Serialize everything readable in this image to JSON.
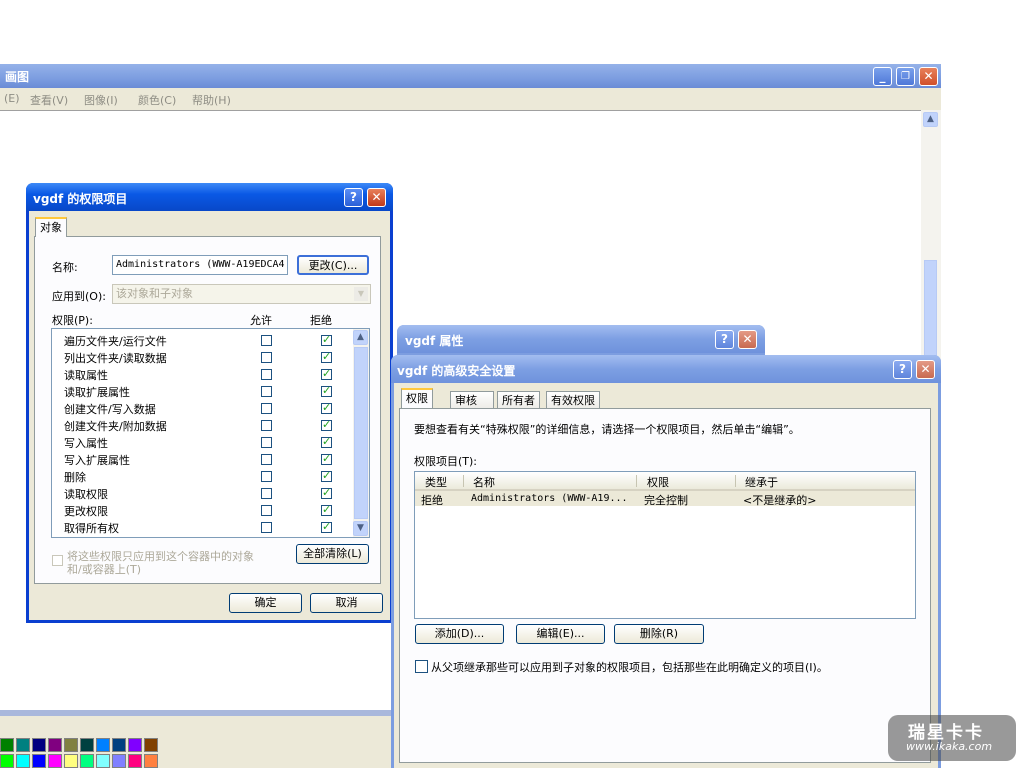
{
  "paint": {
    "title": "画图",
    "menus": [
      "(E)",
      "查看(V)",
      "图像(I)",
      "颜色(C)",
      "帮助(H)"
    ],
    "palette_top": [
      "#008000",
      "#008080",
      "#000080",
      "#800080",
      "#808040",
      "#004040",
      "#0080ff",
      "#004080",
      "#8000ff",
      "#804000"
    ],
    "palette_bottom": [
      "#00ff00",
      "#00ffff",
      "#0000ff",
      "#ff00ff",
      "#ffff80",
      "#00ff80",
      "#80ffff",
      "#8080ff",
      "#ff0080",
      "#ff8040"
    ]
  },
  "perm_entry": {
    "title": "vgdf 的权限项目",
    "tab": "对象",
    "name_label": "名称:",
    "name_value": "Administrators (WWW-A19EDCA4",
    "change_button": "更改(C)...",
    "apply_label": "应用到(O):",
    "apply_value": "该对象和子对象",
    "permissions_label": "权限(P):",
    "col_allow": "允许",
    "col_deny": "拒绝",
    "rows": [
      {
        "label": "遍历文件夹/运行文件",
        "allow": false,
        "deny": true
      },
      {
        "label": "列出文件夹/读取数据",
        "allow": false,
        "deny": true
      },
      {
        "label": "读取属性",
        "allow": false,
        "deny": true
      },
      {
        "label": "读取扩展属性",
        "allow": false,
        "deny": true
      },
      {
        "label": "创建文件/写入数据",
        "allow": false,
        "deny": true
      },
      {
        "label": "创建文件夹/附加数据",
        "allow": false,
        "deny": true
      },
      {
        "label": "写入属性",
        "allow": false,
        "deny": true
      },
      {
        "label": "写入扩展属性",
        "allow": false,
        "deny": true
      },
      {
        "label": "删除",
        "allow": false,
        "deny": true
      },
      {
        "label": "读取权限",
        "allow": false,
        "deny": true
      },
      {
        "label": "更改权限",
        "allow": false,
        "deny": true
      },
      {
        "label": "取得所有权",
        "allow": false,
        "deny": true
      }
    ],
    "apply_only_line1": "将这些权限只应用到这个容器中的对象",
    "apply_only_line2": "和/或容器上(T)",
    "clear_all": "全部清除(L)",
    "ok": "确定",
    "cancel": "取消"
  },
  "properties": {
    "title": "vgdf 属性"
  },
  "advanced": {
    "title": "vgdf 的高级安全设置",
    "tabs": [
      "权限",
      "审核",
      "所有者",
      "有效权限"
    ],
    "info": "要想查看有关“特殊权限”的详细信息，请选择一个权限项目，然后单击“编辑”。",
    "entries_label": "权限项目(T):",
    "columns": [
      "类型",
      "名称",
      "权限",
      "继承于"
    ],
    "rows": [
      {
        "type": "拒绝",
        "name": "Administrators (WWW-A19...",
        "perm": "完全控制",
        "inherit": "<不是继承的>"
      }
    ],
    "add": "添加(D)...",
    "edit": "编辑(E)...",
    "remove": "删除(R)",
    "inherit_text": "从父项继承那些可以应用到子对象的权限项目，包括那些在此明确定义的项目(I)。"
  },
  "watermark": {
    "brand": "瑞星卡卡",
    "url": "www.ikaka.com"
  }
}
